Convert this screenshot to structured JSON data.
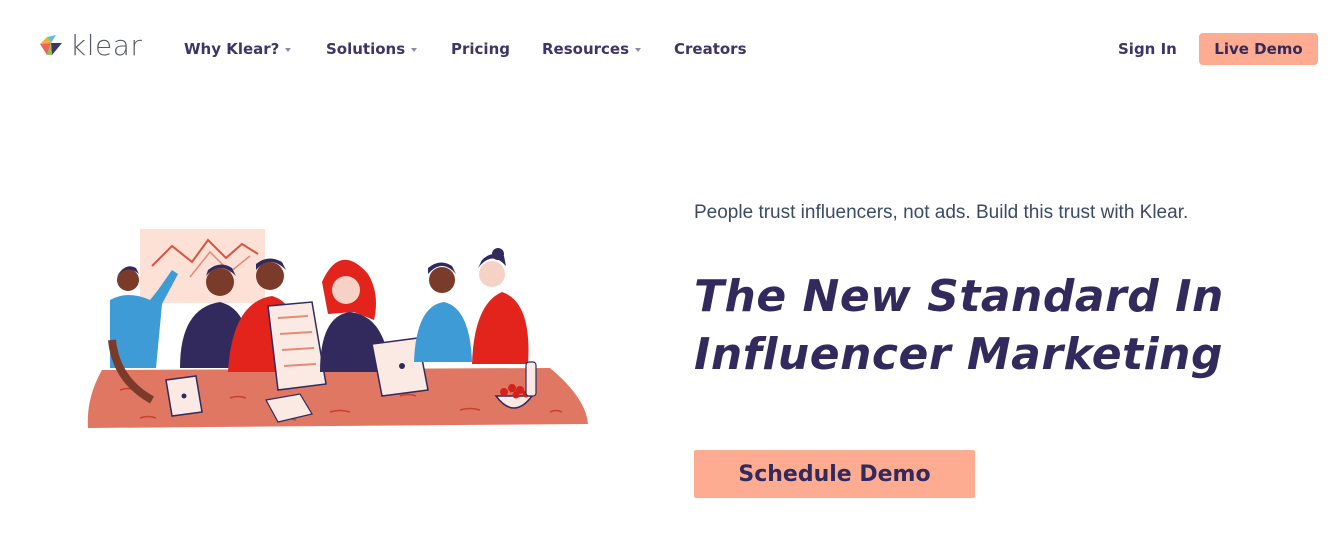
{
  "brand": {
    "name": "klear"
  },
  "nav": {
    "items": [
      {
        "label": "Why Klear?",
        "dropdown": true
      },
      {
        "label": "Solutions",
        "dropdown": true
      },
      {
        "label": "Pricing",
        "dropdown": false
      },
      {
        "label": "Resources",
        "dropdown": true
      },
      {
        "label": "Creators",
        "dropdown": false
      }
    ],
    "sign_in": "Sign In",
    "live_demo": "Live Demo"
  },
  "hero": {
    "tagline": "People trust influencers, not ads. Build this trust with Klear.",
    "headline_line1": "The New Standard In",
    "headline_line2": "Influencer Marketing",
    "cta": "Schedule Demo"
  },
  "colors": {
    "accent": "#fdab91",
    "heading": "#32295c",
    "text": "#3b4a66",
    "table": "#e07763",
    "chart_bg": "#fde0d6"
  },
  "icons": [
    "klear-logo-icon",
    "caret-down-icon",
    "team-illustration"
  ]
}
